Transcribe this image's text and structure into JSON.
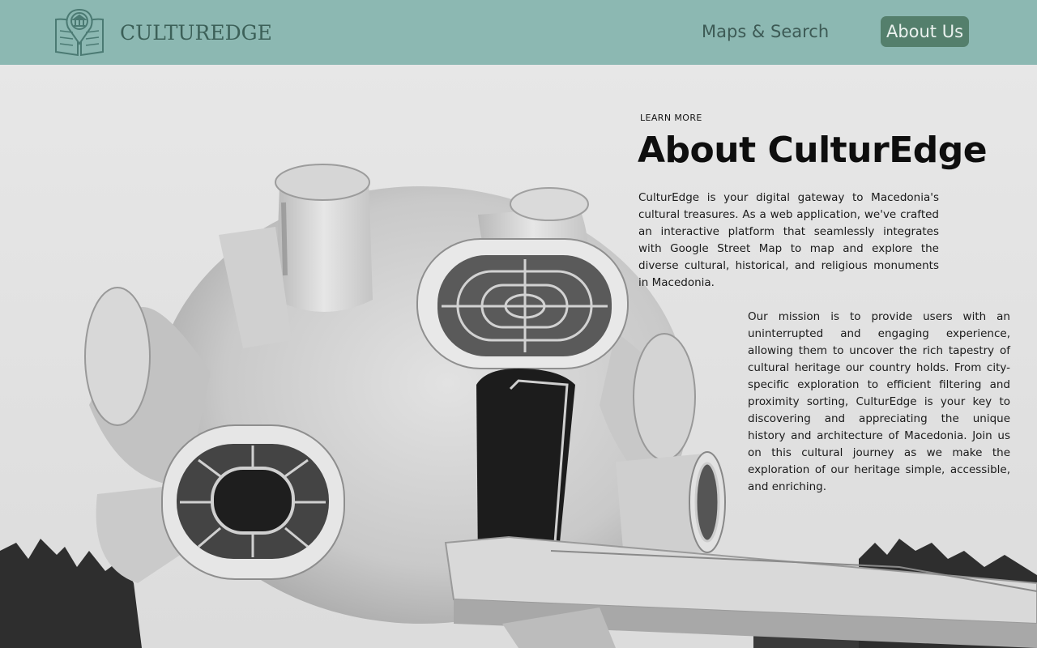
{
  "header": {
    "brand": "CULTUREDGE",
    "logo_icon": "museum-book-pin-icon",
    "nav": {
      "maps_search": "Maps & Search",
      "about_us": "About Us"
    }
  },
  "hero": {
    "image": "monument-photo-grayscale",
    "eyebrow": "LEARN MORE",
    "title": "About CulturEdge",
    "paragraph_1": "CulturEdge is your digital gateway to Macedonia's cultural treasures. As a web application, we've crafted an interactive platform that seamlessly integrates with Google Street Map to map and explore the diverse cultural, historical, and religious monuments in Macedonia.",
    "paragraph_2": "Our mission is to provide users with an uninterrupted and engaging experience, allowing them to uncover the rich tapestry of cultural heritage our country holds. From city-specific exploration to efficient filtering and proximity sorting, CulturEdge is your key to discovering and appreciating the unique history and architecture of Macedonia. Join us on this cultural journey as we make the exploration of our heritage simple, accessible, and enriching."
  },
  "colors": {
    "header_bg": "#8cb8b2",
    "active_nav_bg": "#547f6c",
    "brand_text": "#3c6058"
  }
}
